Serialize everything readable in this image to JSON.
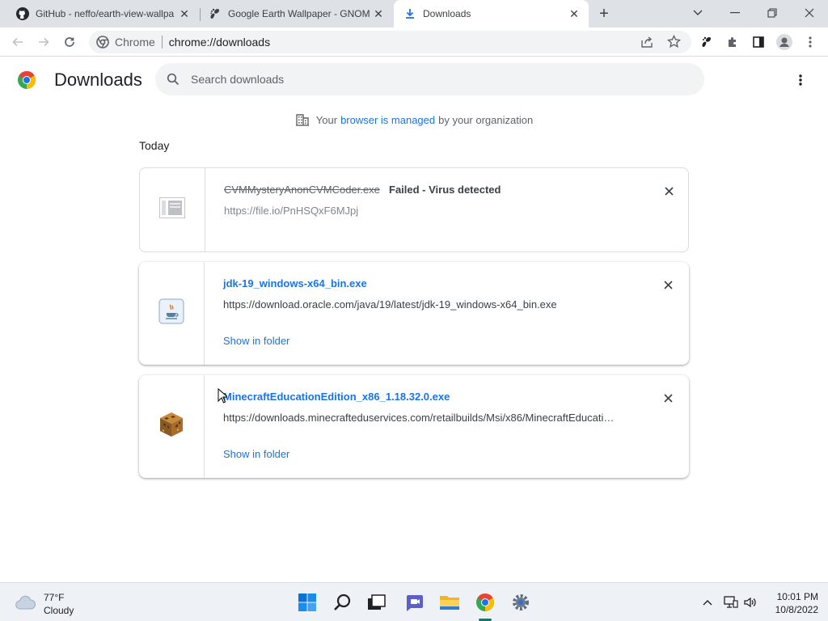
{
  "tabs": [
    {
      "label": "GitHub - neffo/earth-view-wallpa",
      "icon": "github-icon"
    },
    {
      "label": "Google Earth Wallpaper - GNOM",
      "icon": "gnome-icon"
    },
    {
      "label": "Downloads",
      "icon": "download-icon"
    }
  ],
  "toolbar": {
    "omni_site": "Chrome",
    "omni_url": "chrome://downloads"
  },
  "page": {
    "title": "Downloads",
    "search_placeholder": "Search downloads",
    "managed": {
      "prefix": "Your",
      "link": "browser is managed",
      "suffix": "by your organization"
    },
    "day": "Today"
  },
  "downloads": [
    {
      "name": "CVMMysteryAnonCVMCoder.exe",
      "status": "Failed - Virus detected",
      "url": "https://file.io/PnHSQxF6MJpj",
      "icon": "file-icon"
    },
    {
      "name": "jdk-19_windows-x64_bin.exe",
      "url": "https://download.oracle.com/java/19/latest/jdk-19_windows-x64_bin.exe",
      "action": "Show in folder",
      "icon": "java-icon"
    },
    {
      "name": "MinecraftEducationEdition_x86_1.18.32.0.exe",
      "url": "https://downloads.minecrafteduservices.com/retailbuilds/Msi/x86/MinecraftEducati…",
      "action": "Show in folder",
      "icon": "minecraft-icon"
    }
  ],
  "taskbar": {
    "weather_temp": "77°F",
    "weather_desc": "Cloudy",
    "time": "10:01 PM",
    "date": "10/8/2022"
  },
  "colors": {
    "accent": "#1a73e8",
    "tabstrip": "#dee1e6"
  }
}
